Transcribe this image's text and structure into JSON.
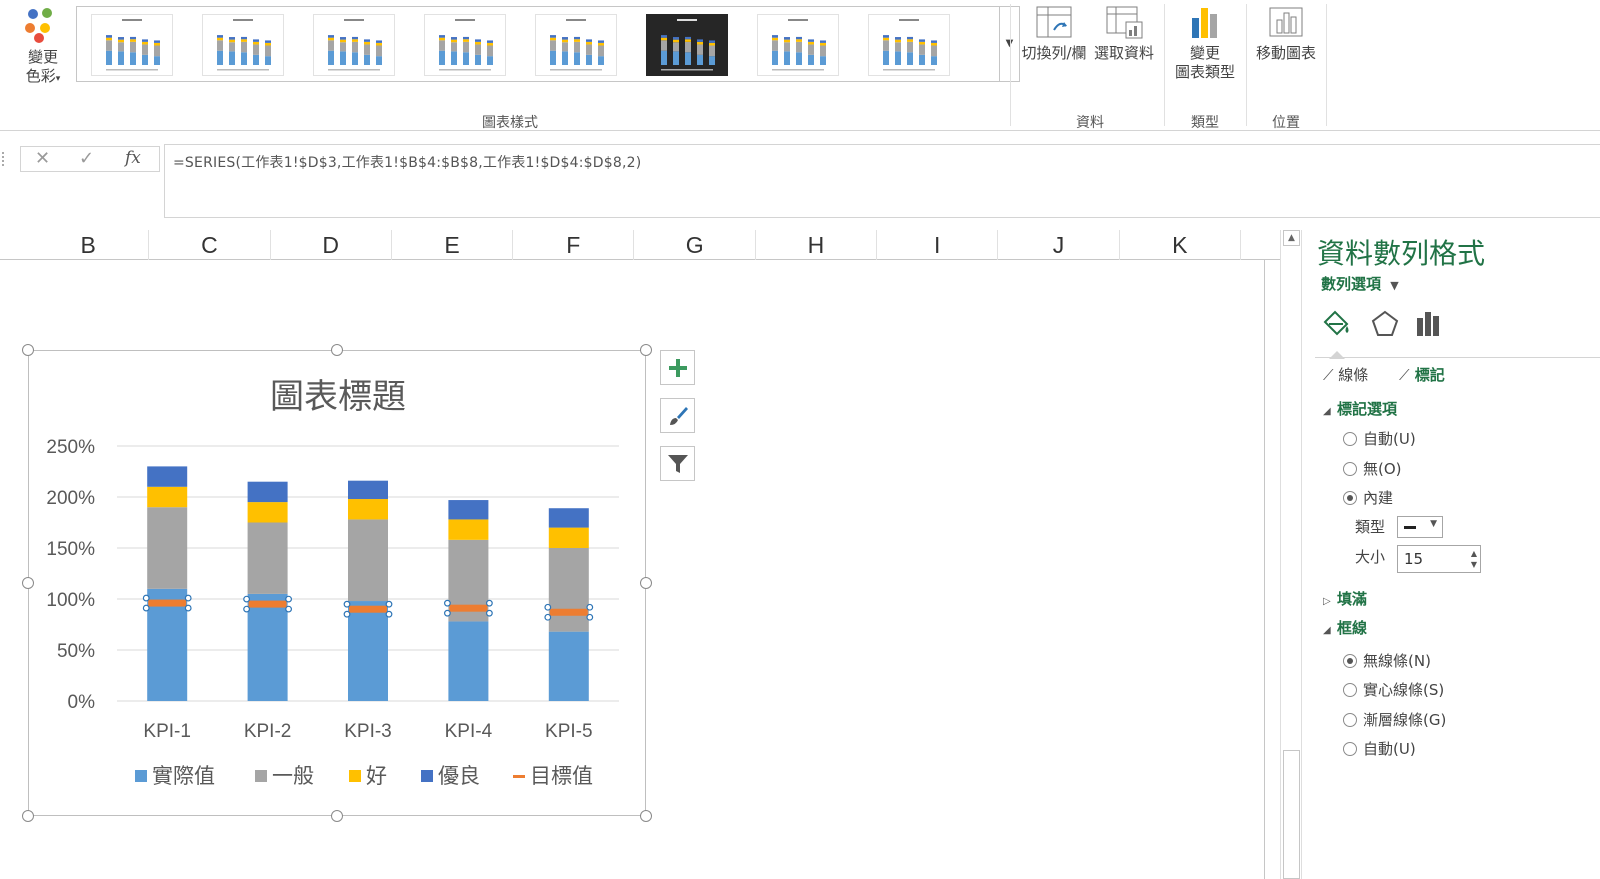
{
  "ribbon": {
    "change_colors": "變更\n色彩",
    "change_colors_l1": "變更",
    "change_colors_l2": "色彩",
    "chart_styles_group": "圖表樣式",
    "switch_row_col": "切換列/欄",
    "select_data": "選取資料",
    "data_group": "資料",
    "change_type_l1": "變更",
    "change_type_l2": "圖表類型",
    "type_group": "類型",
    "move_chart": "移動圖表",
    "location_group": "位置"
  },
  "formula_bar": {
    "cancel_glyph": "✕",
    "enter_glyph": "✓",
    "fx_label": "fx",
    "formula": "=SERIES(工作表1!$D$3,工作表1!$B$4:$B$8,工作表1!$D$4:$D$8,2)"
  },
  "columns": [
    "B",
    "C",
    "D",
    "E",
    "F",
    "G",
    "H",
    "I",
    "J",
    "K"
  ],
  "chart_data": {
    "type": "bar",
    "title": "圖表標題",
    "categories": [
      "KPI-1",
      "KPI-2",
      "KPI-3",
      "KPI-4",
      "KPI-5"
    ],
    "ylim": [
      0,
      250
    ],
    "yticks": [
      "0%",
      "50%",
      "100%",
      "150%",
      "200%",
      "250%"
    ],
    "stacked": true,
    "series": [
      {
        "name": "實際值",
        "color": "#5B9BD5",
        "values": [
          110,
          105,
          98,
          78,
          68
        ]
      },
      {
        "name": "一般",
        "color": "#A5A5A5",
        "values": [
          80,
          70,
          80,
          80,
          82
        ]
      },
      {
        "name": "好",
        "color": "#FFC000",
        "values": [
          20,
          20,
          20,
          20,
          20
        ]
      },
      {
        "name": "優良",
        "color": "#4472C4",
        "values": [
          20,
          20,
          18,
          19,
          19
        ]
      }
    ],
    "target_series": {
      "name": "目標值",
      "color": "#ED7D31",
      "values": [
        96,
        95,
        90,
        91,
        87
      ]
    },
    "legend_position": "bottom",
    "grid": true
  },
  "pane": {
    "title": "資料數列格式",
    "subtitle": "數列選項",
    "tab_line": "線條",
    "tab_marker": "標記",
    "marker_options": "標記選項",
    "auto": "自動(U)",
    "none": "無(O)",
    "builtin": "內建",
    "type_label": "類型",
    "size_label": "大小",
    "size_value": "15",
    "fill": "填滿",
    "border": "框線",
    "no_line": "無線條(N)",
    "solid_line": "實心線條(S)",
    "gradient_line": "漸層線條(G)",
    "auto2": "自動(U)"
  }
}
